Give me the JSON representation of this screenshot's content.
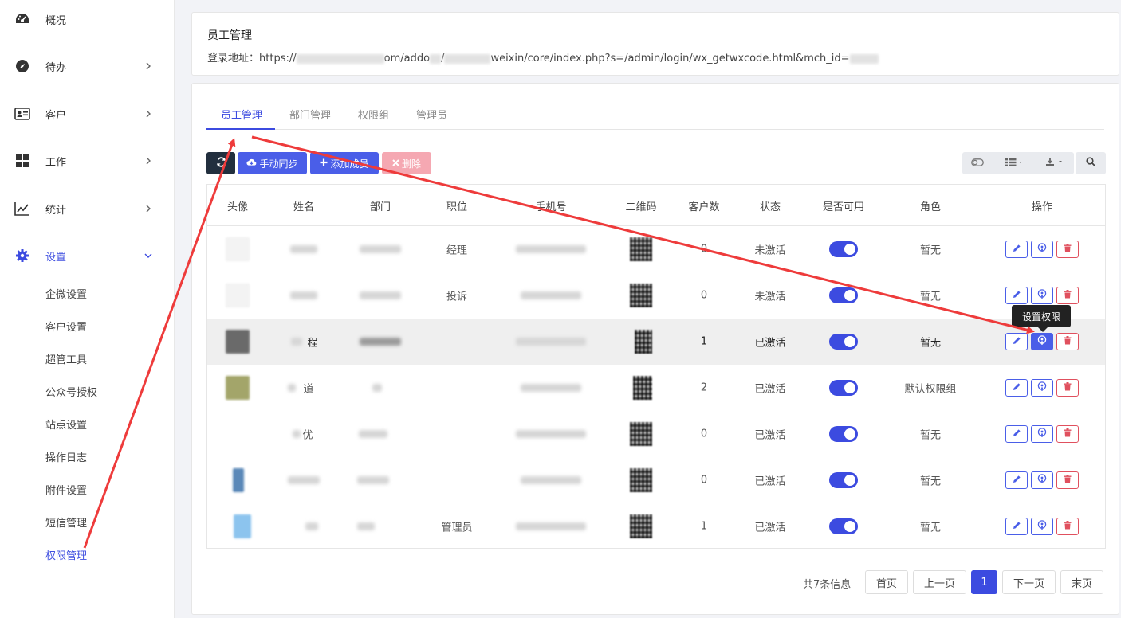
{
  "sidebar": {
    "items": [
      {
        "label": "概况"
      },
      {
        "label": "待办"
      },
      {
        "label": "客户"
      },
      {
        "label": "工作"
      },
      {
        "label": "统计"
      },
      {
        "label": "设置"
      }
    ],
    "sub_items": [
      {
        "label": "企微设置"
      },
      {
        "label": "客户设置"
      },
      {
        "label": "超管工具"
      },
      {
        "label": "公众号授权"
      },
      {
        "label": "站点设置"
      },
      {
        "label": "操作日志"
      },
      {
        "label": "附件设置"
      },
      {
        "label": "短信管理"
      },
      {
        "label": "权限管理"
      }
    ]
  },
  "header": {
    "title": "员工管理",
    "login_label": "登录地址：",
    "url_parts": [
      "https://",
      "om/addo",
      "/",
      "weixin/core/index.php?s=/admin/login/wx_getwxcode.html&mch_id="
    ]
  },
  "tabs": [
    {
      "label": "员工管理"
    },
    {
      "label": "部门管理"
    },
    {
      "label": "权限组"
    },
    {
      "label": "管理员"
    }
  ],
  "toolbar": {
    "sync_label": "手动同步",
    "add_label": "添加成员",
    "delete_label": "删除"
  },
  "table": {
    "columns": [
      "头像",
      "姓名",
      "部门",
      "职位",
      "手机号",
      "二维码",
      "客户数",
      "状态",
      "是否可用",
      "角色",
      "操作"
    ],
    "rows": [
      {
        "name": "",
        "position": "经理",
        "customers": "0",
        "status": "未激活",
        "role": "暂无"
      },
      {
        "name": "",
        "position": "投诉",
        "customers": "0",
        "status": "未激活",
        "role": "暂无"
      },
      {
        "name": "程",
        "position": "",
        "customers": "1",
        "status": "已激活",
        "role": "暂无"
      },
      {
        "name": "道",
        "position": "",
        "customers": "2",
        "status": "已激活",
        "role": "默认权限组"
      },
      {
        "name": "优",
        "position": "",
        "customers": "0",
        "status": "已激活",
        "role": "暂无"
      },
      {
        "name": "",
        "position": "",
        "customers": "0",
        "status": "已激活",
        "role": "暂无"
      },
      {
        "name": "",
        "position": "管理员",
        "customers": "1",
        "status": "已激活",
        "role": "暂无"
      }
    ]
  },
  "tooltip": "设置权限",
  "pagination": {
    "info": "共7条信息",
    "first": "首页",
    "prev": "上一页",
    "current": "1",
    "next": "下一页",
    "last": "末页"
  },
  "colors": {
    "primary": "#3c4be0",
    "dark": "#222f3e",
    "danger": "#e0505e",
    "annotation": "#ee3b3b"
  }
}
